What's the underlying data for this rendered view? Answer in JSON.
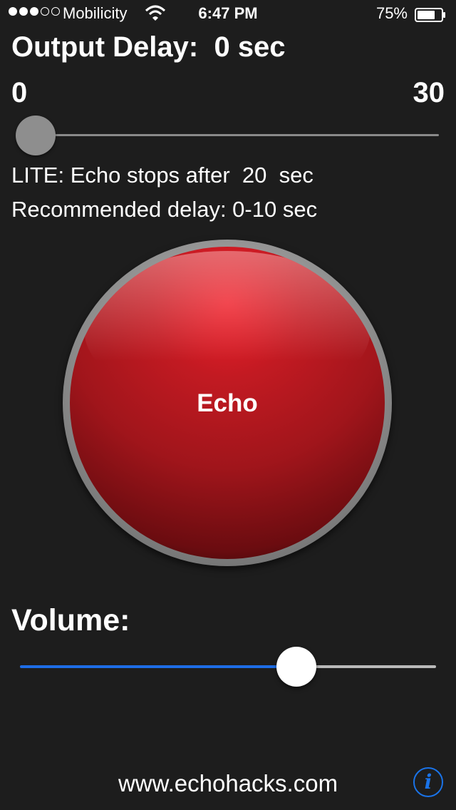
{
  "status_bar": {
    "carrier": "Mobilicity",
    "time": "6:47 PM",
    "battery_percent": "75%",
    "signal_bars_filled": 3,
    "signal_bars_total": 5,
    "battery_level": 0.75
  },
  "delay": {
    "title": "Output Delay:  0 sec",
    "min_label": "0",
    "max_label": "30",
    "value": 0
  },
  "notes": {
    "lite": "LITE: Echo stops after  20  sec",
    "recommended": "Recommended delay: 0-10 sec"
  },
  "echo_button": {
    "label": "Echo"
  },
  "volume": {
    "title": "Volume:",
    "level": 0.66
  },
  "footer": {
    "website": "www.echohacks.com",
    "info_icon": "i"
  },
  "colors": {
    "background": "#1d1d1d",
    "accent_blue": "#1e6de6",
    "echo_red": "#c21a22"
  }
}
